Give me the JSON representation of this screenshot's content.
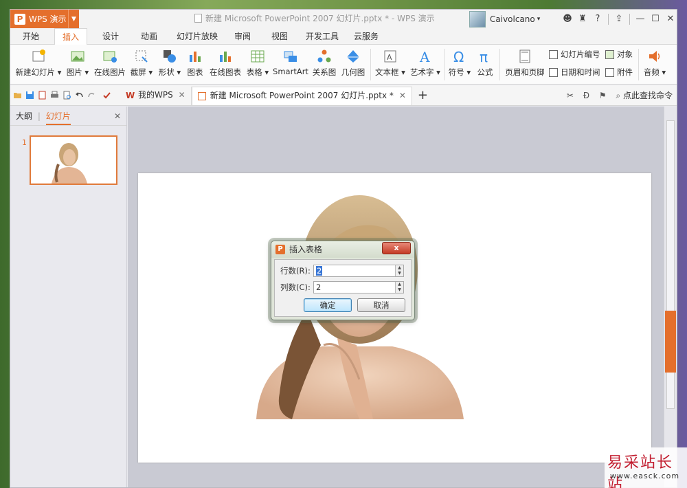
{
  "titlebar": {
    "app_button": "WPS 演示",
    "document_title": "新建 Microsoft PowerPoint 2007 幻灯片.pptx * - WPS 演示",
    "username": "Caivolcano"
  },
  "menu": {
    "tabs": [
      "开始",
      "插入",
      "设计",
      "动画",
      "幻灯片放映",
      "审阅",
      "视图",
      "开发工具",
      "云服务"
    ],
    "active_tab": "插入"
  },
  "ribbon": {
    "new_slide": "新建幻灯片",
    "picture": "图片",
    "online_picture": "在线图片",
    "screenshot": "截屏",
    "shapes": "形状",
    "chart": "图表",
    "online_chart": "在线图表",
    "table": "表格",
    "smartart": "SmartArt",
    "relation": "关系图",
    "geometry": "几何图",
    "textbox": "文本框",
    "wordart": "艺术字",
    "symbol": "符号",
    "formula": "公式",
    "header_footer": "页眉和页脚",
    "slide_number": "幻灯片编号",
    "date_time": "日期和时间",
    "object": "对象",
    "attachment": "附件",
    "audio": "音频"
  },
  "doc_tabs": [
    {
      "label": "我的WPS"
    },
    {
      "label": "新建 Microsoft PowerPoint 2007 幻灯片.pptx *"
    }
  ],
  "find_command": "点此查找命令",
  "panel": {
    "tab_outline": "大纲",
    "tab_slides": "幻灯片",
    "slide_number": "1"
  },
  "dialog": {
    "title": "插入表格",
    "close": "x",
    "rows_label": "行数(R):",
    "rows_value": "2",
    "cols_label": "列数(C):",
    "cols_value": "2",
    "ok": "确定",
    "cancel": "取消"
  },
  "watermark": {
    "text": "易采站长站",
    "url": "www.easck.com"
  },
  "colors": {
    "accent": "#e46f2c",
    "dialog_close": "#c43b25"
  }
}
